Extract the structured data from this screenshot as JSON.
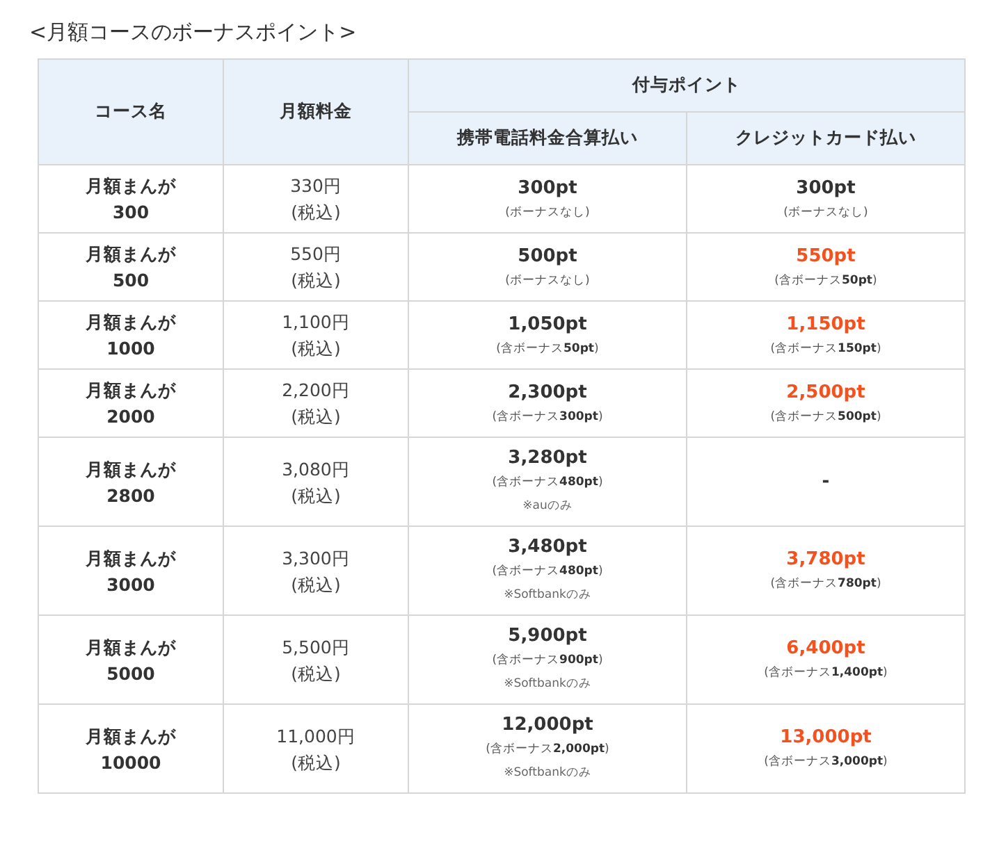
{
  "title": "<月額コースのボーナスポイント>",
  "header": {
    "course": "コース名",
    "price": "月額料金",
    "points": "付与ポイント",
    "carrier": "携帯電話料金合算払い",
    "card": "クレジットカード払い"
  },
  "rows": [
    {
      "course": "月額まんが\n300",
      "price": "330円\n(税込)",
      "carrier": {
        "amount": "300pt",
        "bonus": "(ボーナスなし)",
        "highlight": false
      },
      "card": {
        "amount": "300pt",
        "bonus": "(ボーナスなし)",
        "highlight": false
      }
    },
    {
      "course": "月額まんが\n500",
      "price": "550円\n(税込)",
      "carrier": {
        "amount": "500pt",
        "bonus": "(ボーナスなし)",
        "highlight": false
      },
      "card": {
        "amount": "550pt",
        "bonus": "(含ボーナス**50pt**)",
        "highlight": true
      }
    },
    {
      "course": "月額まんが\n1000",
      "price": "1,100円\n(税込)",
      "carrier": {
        "amount": "1,050pt",
        "bonus": "(含ボーナス**50pt**)",
        "highlight": false
      },
      "card": {
        "amount": "1,150pt",
        "bonus": "(含ボーナス**150pt**)",
        "highlight": true
      }
    },
    {
      "course": "月額まんが\n2000",
      "price": "2,200円\n(税込)",
      "carrier": {
        "amount": "2,300pt",
        "bonus": "(含ボーナス**300pt**)",
        "highlight": false
      },
      "card": {
        "amount": "2,500pt",
        "bonus": "(含ボーナス**500pt**)",
        "highlight": true
      }
    },
    {
      "course": "月額まんが\n2800",
      "price": "3,080円\n(税込)",
      "carrier": {
        "amount": "3,280pt",
        "bonus": "(含ボーナス**480pt**)",
        "note": "※auのみ",
        "highlight": false
      },
      "card": {
        "amount": "-",
        "highlight": false
      }
    },
    {
      "course": "月額まんが\n3000",
      "price": "3,300円\n(税込)",
      "carrier": {
        "amount": "3,480pt",
        "bonus": "(含ボーナス**480pt**)",
        "note": "※Softbankのみ",
        "highlight": false
      },
      "card": {
        "amount": "3,780pt",
        "bonus": "(含ボーナス**780pt**)",
        "highlight": true
      }
    },
    {
      "course": "月額まんが\n5000",
      "price": "5,500円\n(税込)",
      "carrier": {
        "amount": "5,900pt",
        "bonus": "(含ボーナス**900pt**)",
        "note": "※Softbankのみ",
        "highlight": false
      },
      "card": {
        "amount": "6,400pt",
        "bonus": "(含ボーナス**1,400pt**)",
        "highlight": true
      }
    },
    {
      "course": "月額まんが\n10000",
      "price": "11,000円\n(税込)",
      "carrier": {
        "amount": "12,000pt",
        "bonus": "(含ボーナス**2,000pt**)",
        "note": "※Softbankのみ",
        "highlight": false
      },
      "card": {
        "amount": "13,000pt",
        "bonus": "(含ボーナス**3,000pt**)",
        "highlight": true
      }
    }
  ]
}
